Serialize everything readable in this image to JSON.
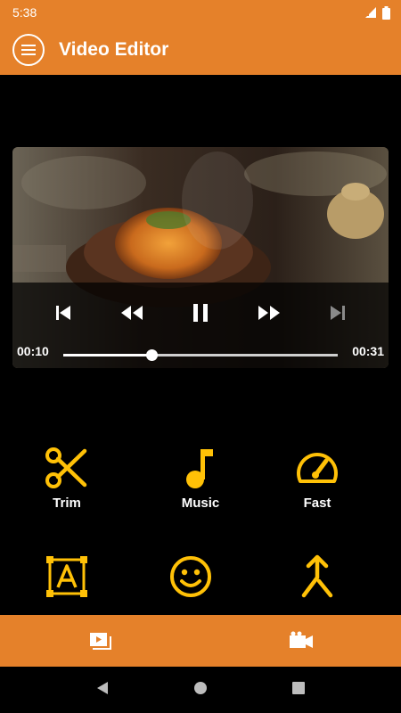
{
  "status_bar": {
    "time": "5:38"
  },
  "app_bar": {
    "title": "Video Editor"
  },
  "player": {
    "current_time": "00:10",
    "duration": "00:31",
    "progress": 0.32
  },
  "tools": [
    {
      "label": "Trim",
      "icon": "scissors-icon"
    },
    {
      "label": "Music",
      "icon": "music-note-icon"
    },
    {
      "label": "Fast",
      "icon": "speedometer-icon"
    },
    {
      "label": "",
      "icon": "text-box-icon"
    },
    {
      "label": "",
      "icon": "emoji-icon"
    },
    {
      "label": "",
      "icon": "merge-icon"
    }
  ],
  "bottom_tabs": [
    {
      "icon": "video-library-icon"
    },
    {
      "icon": "video-camera-icon"
    }
  ],
  "colors": {
    "accent": "#e5812a",
    "tool_icon": "#ffc107",
    "background": "#000000"
  }
}
